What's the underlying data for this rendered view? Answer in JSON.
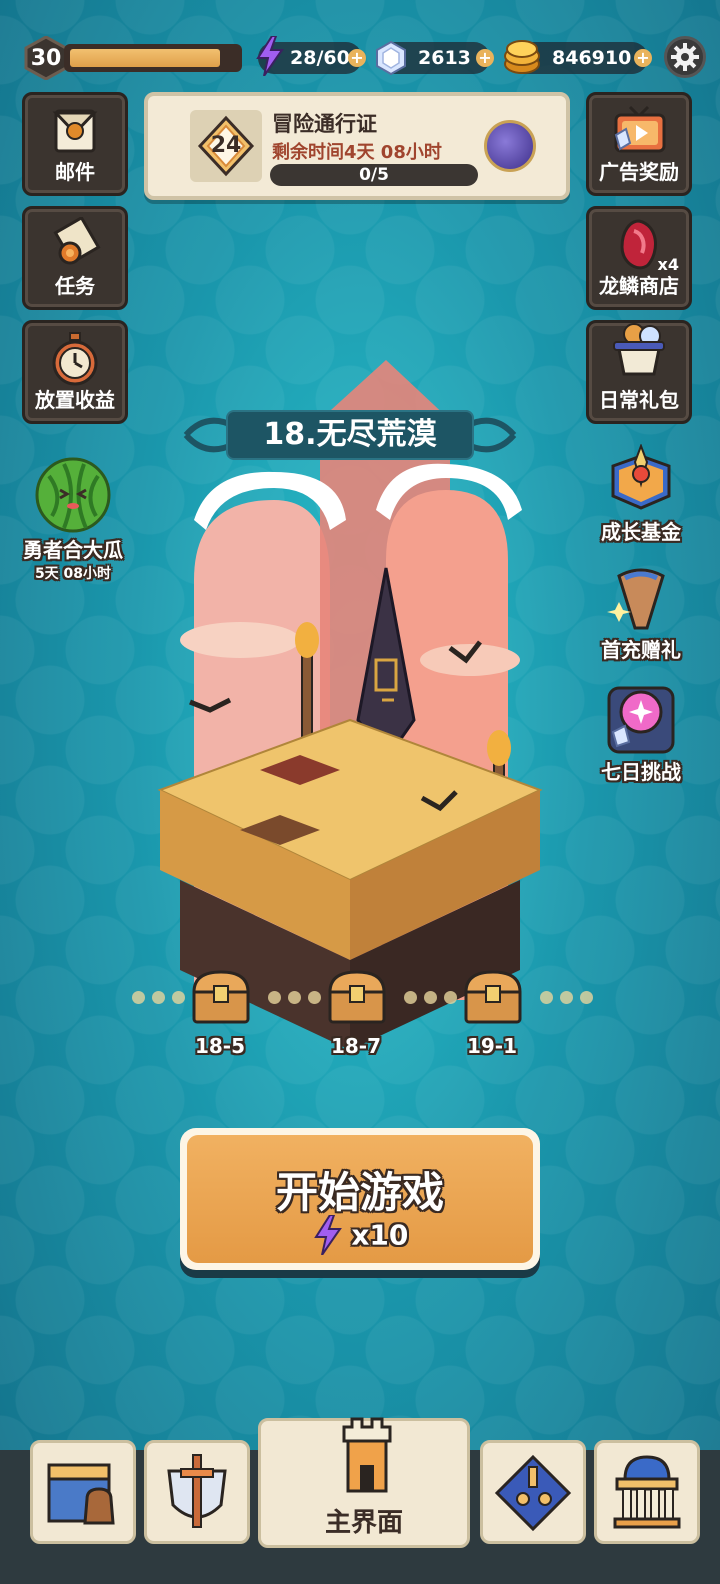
{
  "player": {
    "level": "30",
    "xp_fraction": 0.95
  },
  "resources": {
    "energy": "28/60",
    "gems": "2613",
    "gold": "846910"
  },
  "left_menu": [
    {
      "label": "邮件",
      "icon": "mail-icon"
    },
    {
      "label": "任务",
      "icon": "scroll-icon"
    },
    {
      "label": "放置收益",
      "icon": "stopwatch-icon"
    }
  ],
  "event": {
    "label": "勇者合大瓜",
    "timer": "5天 08小时",
    "icon": "watermelon-icon"
  },
  "pass": {
    "level": "24",
    "title": "冒险通行证",
    "time_left": "剩余时间4天 08小时",
    "progress": "0/5",
    "progress_fraction": 0
  },
  "right_menu": [
    {
      "label": "广告奖励",
      "icon": "tv-ad-icon"
    },
    {
      "label": "龙鳞商店",
      "icon": "dragon-scale-icon",
      "badge": "x4"
    },
    {
      "label": "日常礼包",
      "icon": "gift-pot-icon"
    },
    {
      "label": "成长基金",
      "icon": "growth-fund-icon"
    },
    {
      "label": "首充赠礼",
      "icon": "first-charge-icon"
    },
    {
      "label": "七日挑战",
      "icon": "seven-day-icon"
    }
  ],
  "stage": {
    "title": "18.无尽荒漠"
  },
  "milestones": [
    "18-5",
    "18-7",
    "19-1"
  ],
  "start": {
    "label": "开始游戏",
    "cost": "x10"
  },
  "nav": [
    {
      "label": "",
      "icon": "shop-bag-icon"
    },
    {
      "label": "",
      "icon": "sword-shield-icon"
    },
    {
      "label": "主界面",
      "icon": "castle-tower-icon"
    },
    {
      "label": "",
      "icon": "talent-tree-icon"
    },
    {
      "label": "",
      "icon": "museum-icon"
    }
  ],
  "colors": {
    "accent": "#e9a24e",
    "panel": "#f3ead6",
    "dark": "#3b342f",
    "energy": "#9a4ee8"
  }
}
